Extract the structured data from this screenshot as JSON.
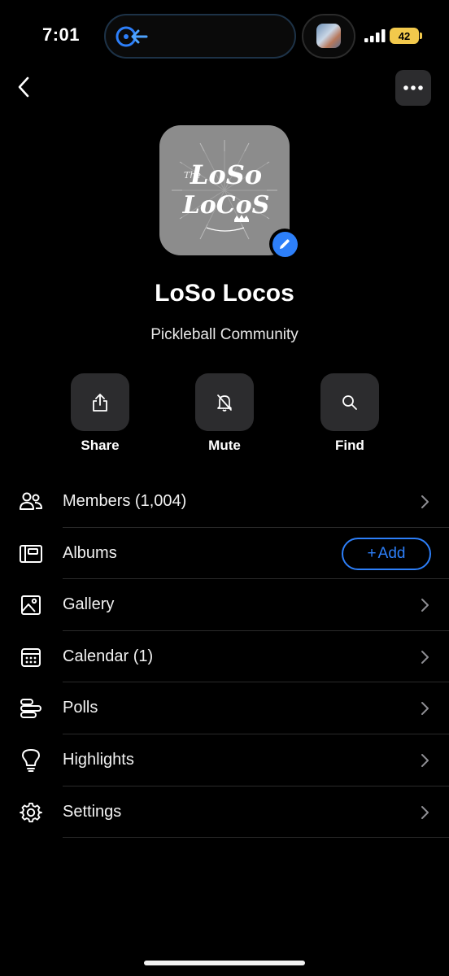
{
  "status_bar": {
    "time": "7:01",
    "battery": "42"
  },
  "group": {
    "name": "LoSo Locos",
    "subtitle": "Pickleball Community",
    "logo_text": "LoSo Locos",
    "logo_small": "The"
  },
  "actions": [
    {
      "label": "Share",
      "icon": "share-icon"
    },
    {
      "label": "Mute",
      "icon": "bell-slash-icon"
    },
    {
      "label": "Find",
      "icon": "search-icon"
    }
  ],
  "menu": {
    "members": "Members (1,004)",
    "albums": "Albums",
    "albums_add": "Add",
    "gallery": "Gallery",
    "calendar": "Calendar (1)",
    "polls": "Polls",
    "highlights": "Highlights",
    "settings": "Settings"
  },
  "colors": {
    "accent": "#2d7ff9",
    "background": "#000000",
    "button_bg": "#2c2c2e",
    "battery": "#f2c94c"
  }
}
